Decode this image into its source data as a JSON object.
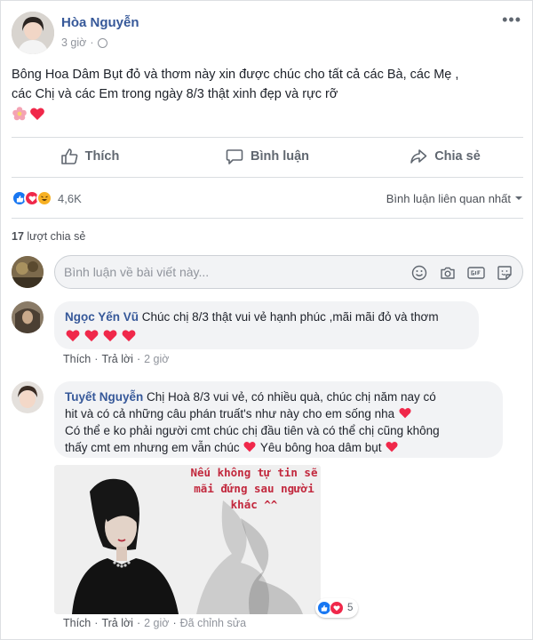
{
  "post": {
    "author": "Hòa Nguyễn",
    "time": "3 giờ",
    "more": "•••",
    "text_line1": "Bông Hoa Dâm Bụt đỏ và thơm này xin được chúc cho tất cả các Bà, các Mẹ ,",
    "text_line2": "các Chị và các Em trong ngày 8/3 thật xinh đẹp và rực rỡ"
  },
  "actions": {
    "like": "Thích",
    "comment": "Bình luận",
    "share": "Chia sẻ"
  },
  "reactions": {
    "count": "4,6K",
    "sort_label": "Bình luận liên quan nhất"
  },
  "shares": {
    "count": "17",
    "label": "lượt chia sẻ"
  },
  "comment_input": {
    "placeholder": "Bình luận về bài viết này..."
  },
  "comments": [
    {
      "name": "Ngọc Yến Vũ",
      "text": "Chúc chị 8/3 thật vui vẻ hạnh phúc ,mãi mãi đỏ và thơm",
      "like": "Thích",
      "reply": "Trả lời",
      "time": "2 giờ"
    },
    {
      "name": "Tuyết Nguyễn",
      "line1": "Chị Hoà 8/3 vui vẻ, có nhiều quà, chúc chị năm nay có",
      "line2": "hit và có cả những câu phán truất's như này cho em sống nha",
      "line3": "Có thể e ko phải người cmt chúc chị đầu tiên và có thể chị cũng không",
      "line4": "thấy cmt em nhưng em vẫn chúc",
      "line4b": "Yêu bông hoa dâm bụt",
      "photo_caption": "Nếu không tự tin sẽ mãi đứng sau người khác ^^",
      "reaction_count": "5",
      "like": "Thích",
      "reply": "Trả lời",
      "time": "2 giờ",
      "edited": "Đã chỉnh sửa"
    }
  ],
  "colors": {
    "link": "#365899",
    "like_blue": "#1877f2",
    "heart_red": "#f0284a",
    "haha_yellow": "#f7b125"
  }
}
